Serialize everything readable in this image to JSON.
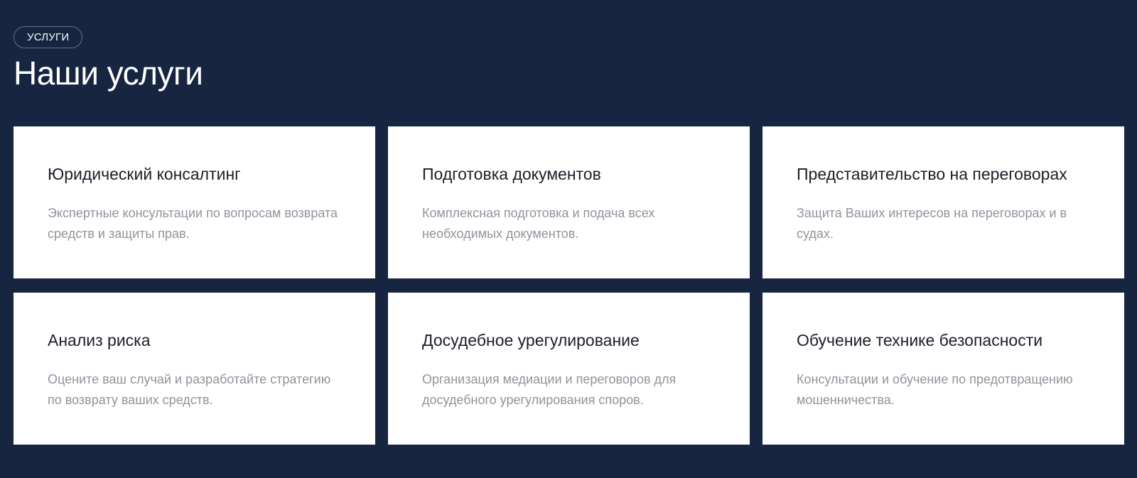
{
  "header": {
    "tag": "УСЛУГИ",
    "title": "Наши услуги"
  },
  "services": [
    {
      "title": "Юридический консалтинг",
      "description": "Экспертные консультации по вопросам возврата средств и защиты прав."
    },
    {
      "title": "Подготовка документов",
      "description": "Комплексная подготовка и подача всех необходимых документов."
    },
    {
      "title": "Представительство на переговорах",
      "description": "Защита Ваших интересов на переговорах и в судах."
    },
    {
      "title": "Анализ риска",
      "description": "Оцените ваш случай и разработайте стратегию по возврату ваших средств."
    },
    {
      "title": "Досудебное урегулирование",
      "description": "Организация медиации и переговоров для досудебного урегулирования споров."
    },
    {
      "title": "Обучение технике безопасности",
      "description": "Консультации и обучение по предотвращению мошенничества."
    }
  ],
  "colors": {
    "background": "#172540",
    "card": "#ffffff",
    "card_title": "#1b1f2a",
    "card_text": "#8f949c"
  }
}
